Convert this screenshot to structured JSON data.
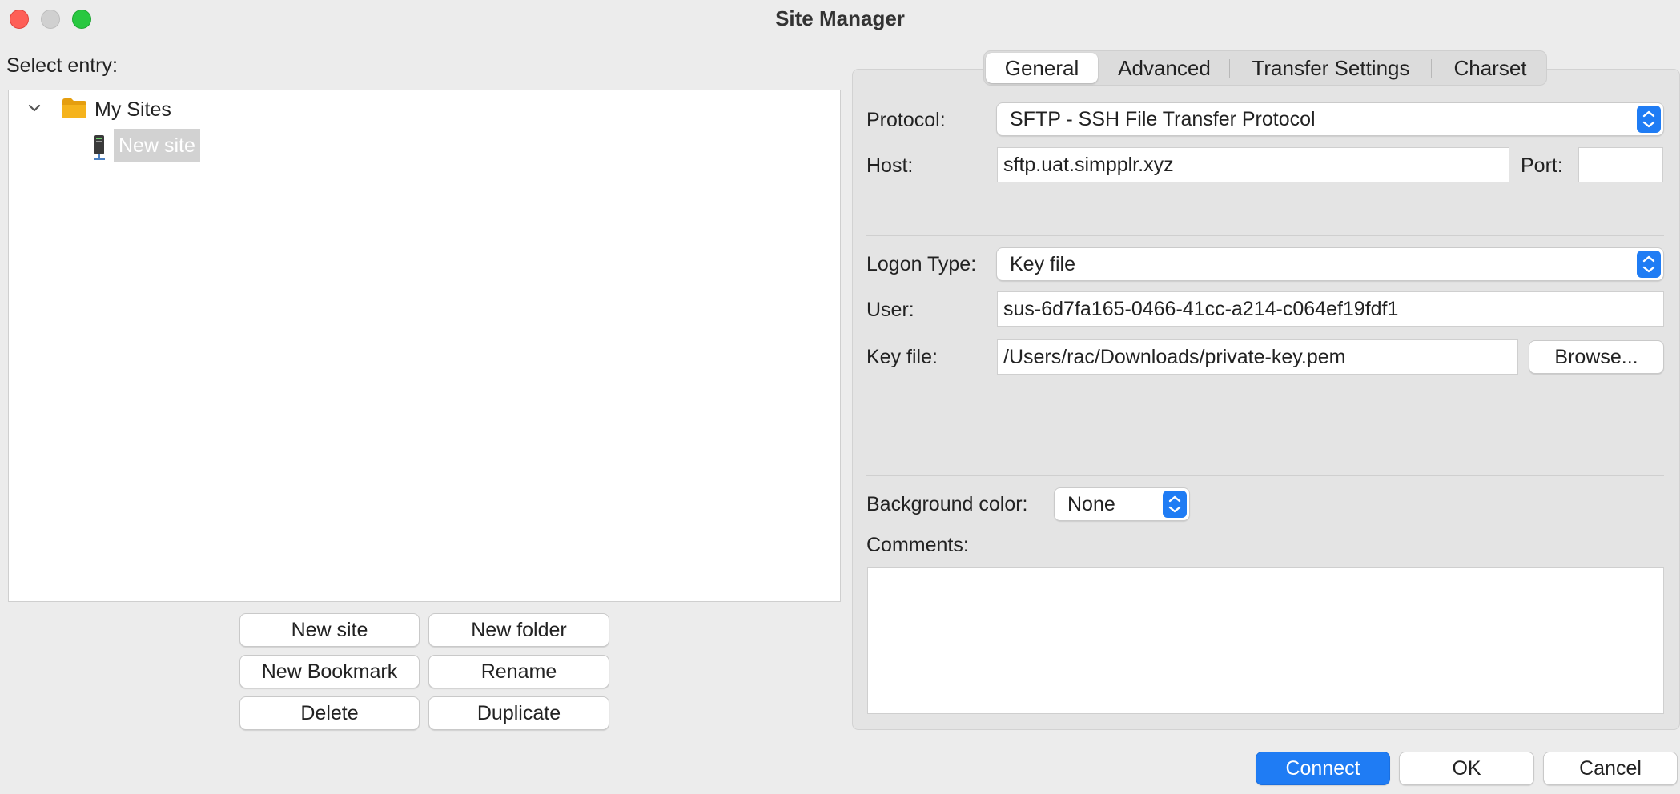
{
  "window": {
    "title": "Site Manager"
  },
  "left": {
    "select_entry_label": "Select entry:",
    "tree": {
      "folder_label": "My Sites",
      "site_label": "New site"
    },
    "buttons": {
      "new_site": "New site",
      "new_folder": "New folder",
      "new_bookmark": "New Bookmark",
      "rename": "Rename",
      "delete": "Delete",
      "duplicate": "Duplicate"
    }
  },
  "tabs": [
    "General",
    "Advanced",
    "Transfer Settings",
    "Charset"
  ],
  "general": {
    "protocol_label": "Protocol:",
    "protocol_value": "SFTP - SSH File Transfer Protocol",
    "host_label": "Host:",
    "host_value": "sftp.uat.simpplr.xyz",
    "port_label": "Port:",
    "port_value": "",
    "logon_type_label": "Logon Type:",
    "logon_type_value": "Key file",
    "user_label": "User:",
    "user_value": "sus-6d7fa165-0466-41cc-a214-c064ef19fdf1",
    "key_file_label": "Key file:",
    "key_file_value": "/Users/rac/Downloads/private-key.pem",
    "browse_label": "Browse...",
    "background_color_label": "Background color:",
    "background_color_value": "None",
    "comments_label": "Comments:",
    "comments_value": ""
  },
  "footer": {
    "connect": "Connect",
    "ok": "OK",
    "cancel": "Cancel"
  },
  "colors": {
    "accent": "#1f7cf4",
    "close": "#fe5f57",
    "minimize": "#d0d0d0",
    "zoom": "#28c840",
    "selection": "#d2d2d2",
    "folder": "#f5b31c"
  }
}
